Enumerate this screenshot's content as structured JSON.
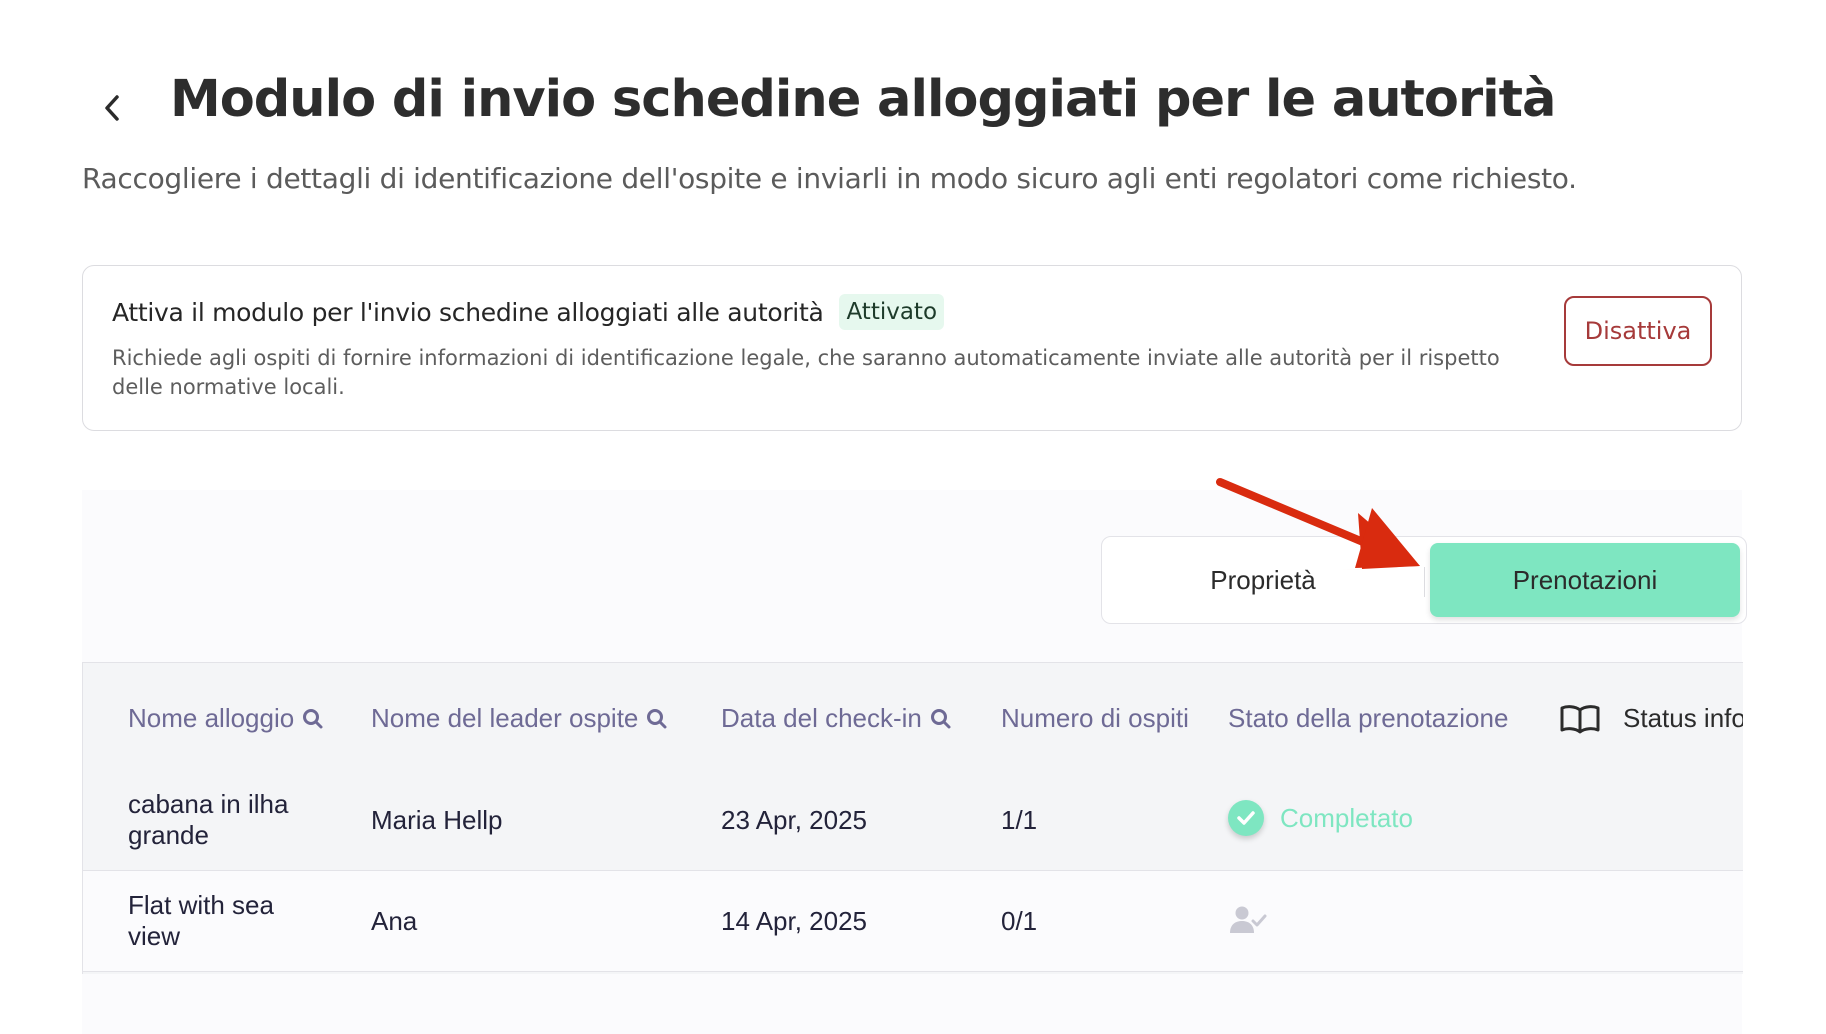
{
  "header": {
    "title": "Modulo di invio schedine alloggiati per le autorità",
    "subtitle": "Raccogliere i dettagli di identificazione dell'ospite e inviarli in modo sicuro agli enti regolatori come richiesto."
  },
  "module_card": {
    "title": "Attiva il modulo per l'invio schedine alloggiati alle autorità",
    "badge": "Attivato",
    "description": "Richiede agli ospiti di fornire informazioni di identificazione legale, che saranno automaticamente inviate alle autorità per il rispetto delle normative locali.",
    "disable_button": "Disattiva"
  },
  "view_toggle": {
    "options": [
      "Proprietà",
      "Prenotazioni"
    ],
    "selected": "Prenotazioni"
  },
  "table": {
    "columns": [
      "Nome alloggio",
      "Nome del leader ospite",
      "Data del check-in",
      "Numero di ospiti",
      "Stato della prenotazione",
      "Status info"
    ],
    "rows": [
      {
        "property_line1": "cabana in ilha",
        "property_line2": "grande",
        "leader": "Maria Hellp",
        "checkin": "23 Apr, 2025",
        "guests": "1/1",
        "status": "Completato",
        "status_icon": "check-circle-icon"
      },
      {
        "property_line1": "Flat with sea",
        "property_line2": "view",
        "leader": "Ana",
        "checkin": "14 Apr, 2025",
        "guests": "0/1",
        "status": "",
        "status_icon": "user-check-icon"
      }
    ]
  },
  "colors": {
    "accent": "#7ee6c1",
    "danger": "#a63a3a",
    "annotation_arrow": "#d92b0f",
    "header_text": "#6e6a95"
  }
}
